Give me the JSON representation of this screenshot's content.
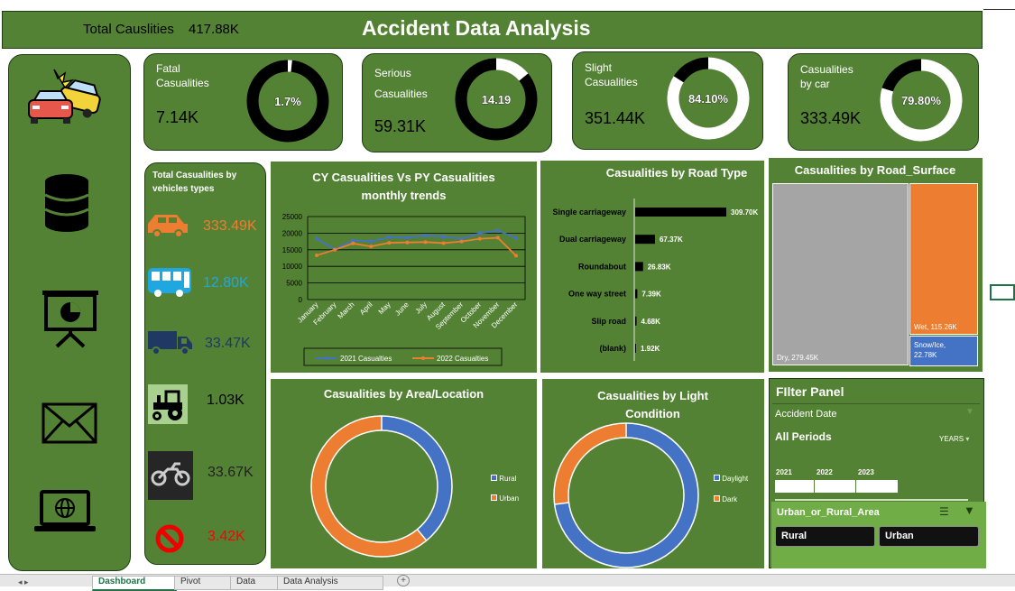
{
  "header": {
    "total_label": "Total Causlities",
    "total_value": "417.88K",
    "title": "Accident Data Analysis"
  },
  "sidebar": {
    "icons": [
      "car-crash-icon",
      "database-icon",
      "presentation-icon",
      "mail-icon",
      "laptop-globe-icon"
    ]
  },
  "kpis": [
    {
      "label1": "Fatal",
      "label2": "Casualities",
      "value": "7.14K",
      "pct_text": "1.7%",
      "pct": 0.017
    },
    {
      "label1": "Serious",
      "label2": "Casualities",
      "value": "59.31K",
      "pct_text": "14.19",
      "pct": 0.1419
    },
    {
      "label1": "Slight",
      "label2": "Casualities",
      "value": "351.44K",
      "pct_text": "84.10%",
      "pct": 0.841
    },
    {
      "label1": "Casualities",
      "label2": "by car",
      "value": "333.49K",
      "pct_text": "79.80%",
      "pct": 0.798
    }
  ],
  "vehicles": {
    "title": "Total Casualities by vehicles types",
    "items": [
      {
        "icon": "car-icon",
        "value": "333.49K",
        "color": "#ed7d31"
      },
      {
        "icon": "bus-icon",
        "value": "12.80K",
        "color": "#1ea7e1"
      },
      {
        "icon": "truck-icon",
        "value": "33.47K",
        "color": "#1f3864"
      },
      {
        "icon": "tractor-icon",
        "value": "1.03K",
        "color": "#000000"
      },
      {
        "icon": "motorcycle-icon",
        "value": "33.67K",
        "color": "#222222"
      },
      {
        "icon": "prohibited-icon",
        "value": "3.42K",
        "color": "#ff0000"
      }
    ]
  },
  "colors": {
    "green": "#548235",
    "blue": "#4472c4",
    "orange": "#ed7d31",
    "gray": "#a5a5a5"
  },
  "chart_data": [
    {
      "type": "line",
      "title": "CY Casualities Vs PY Casualities monthly trends",
      "categories": [
        "January",
        "February",
        "March",
        "April",
        "May",
        "June",
        "July",
        "August",
        "September",
        "October",
        "November",
        "December"
      ],
      "yticks": [
        "25000",
        "20000",
        "15000",
        "10000",
        "5000",
        "0"
      ],
      "ylim": [
        0,
        25000
      ],
      "series": [
        {
          "name": "2021 Casualties",
          "color": "#4472c4",
          "values": [
            18300,
            15200,
            17800,
            17500,
            18800,
            18600,
            19300,
            18900,
            18300,
            20000,
            20800,
            18500
          ]
        },
        {
          "name": "2022 Casualties",
          "color": "#ed7d31",
          "values": [
            13300,
            15000,
            16900,
            16000,
            17100,
            17200,
            17300,
            17000,
            17500,
            18300,
            18600,
            13200
          ]
        }
      ],
      "legend": "bottom"
    },
    {
      "type": "bar",
      "title": "Casualities by Road Type",
      "categories": [
        "Single carriageway",
        "Dual carriageway",
        "Roundabout",
        "One way street",
        "Slip road",
        "(blank)"
      ],
      "values": [
        309700,
        67370,
        26830,
        7390,
        4680,
        1920
      ],
      "labels": [
        "309.70K",
        "67.37K",
        "26.83K",
        "7.39K",
        "4.68K",
        "1.92K"
      ]
    },
    {
      "type": "heatmap",
      "title": "Casualities by Road_Surface",
      "items": [
        {
          "name": "Dry",
          "label": "Dry, 279.45K",
          "value": 279450,
          "color": "#a5a5a5"
        },
        {
          "name": "Wet",
          "label": "Wet, 115.26K",
          "value": 115260,
          "color": "#ed7d31"
        },
        {
          "name": "Snow/Ice",
          "label": "Snow/Ice, 22.78K",
          "value": 22780,
          "color": "#4472c4"
        }
      ]
    },
    {
      "type": "pie",
      "title": "Casualities by Area/Location",
      "items": [
        {
          "name": "Rural",
          "value": 0.39,
          "color": "#4472c4"
        },
        {
          "name": "Urban",
          "value": 0.61,
          "color": "#ed7d31"
        }
      ],
      "legend": "right"
    },
    {
      "type": "pie",
      "title": "Casualities by Light Condition",
      "items": [
        {
          "name": "Daylight",
          "value": 0.73,
          "color": "#4472c4"
        },
        {
          "name": "Dark",
          "value": 0.27,
          "color": "#ed7d31"
        }
      ],
      "legend": "right"
    }
  ],
  "filter": {
    "title": "FIlter Panel",
    "date_label": "Accident  Date",
    "period": "All Periods",
    "years_label": "YEARS",
    "years": [
      "2021",
      "2022",
      "2023"
    ],
    "slicer_title": "Urban_or_Rural_Area",
    "buttons": [
      "Rural",
      "Urban"
    ]
  },
  "tabs": [
    "Dashboard",
    "Pivot",
    "Data",
    "Data Analysis"
  ]
}
